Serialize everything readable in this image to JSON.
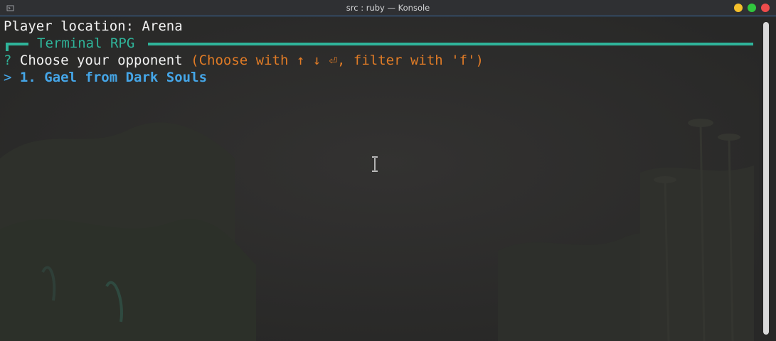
{
  "window": {
    "title": "src : ruby — Konsole"
  },
  "terminal": {
    "location_line": "Player location: Arena",
    "frame_title": "Terminal RPG",
    "prompt": {
      "mark": "?",
      "question": "Choose your opponent",
      "hint": "(Choose with ↑ ↓ ⏎, filter with 'f')"
    },
    "selection": {
      "arrow": ">",
      "item": "1. Gael from Dark Souls"
    }
  },
  "colors": {
    "accent": "#2fb49a",
    "hint": "#e07b26",
    "selected": "#45a6e8",
    "text": "#f2f2f2",
    "background": "#2b2b2a"
  },
  "icons": {
    "app": "konsole-icon",
    "pointer": "text-cursor-icon"
  }
}
